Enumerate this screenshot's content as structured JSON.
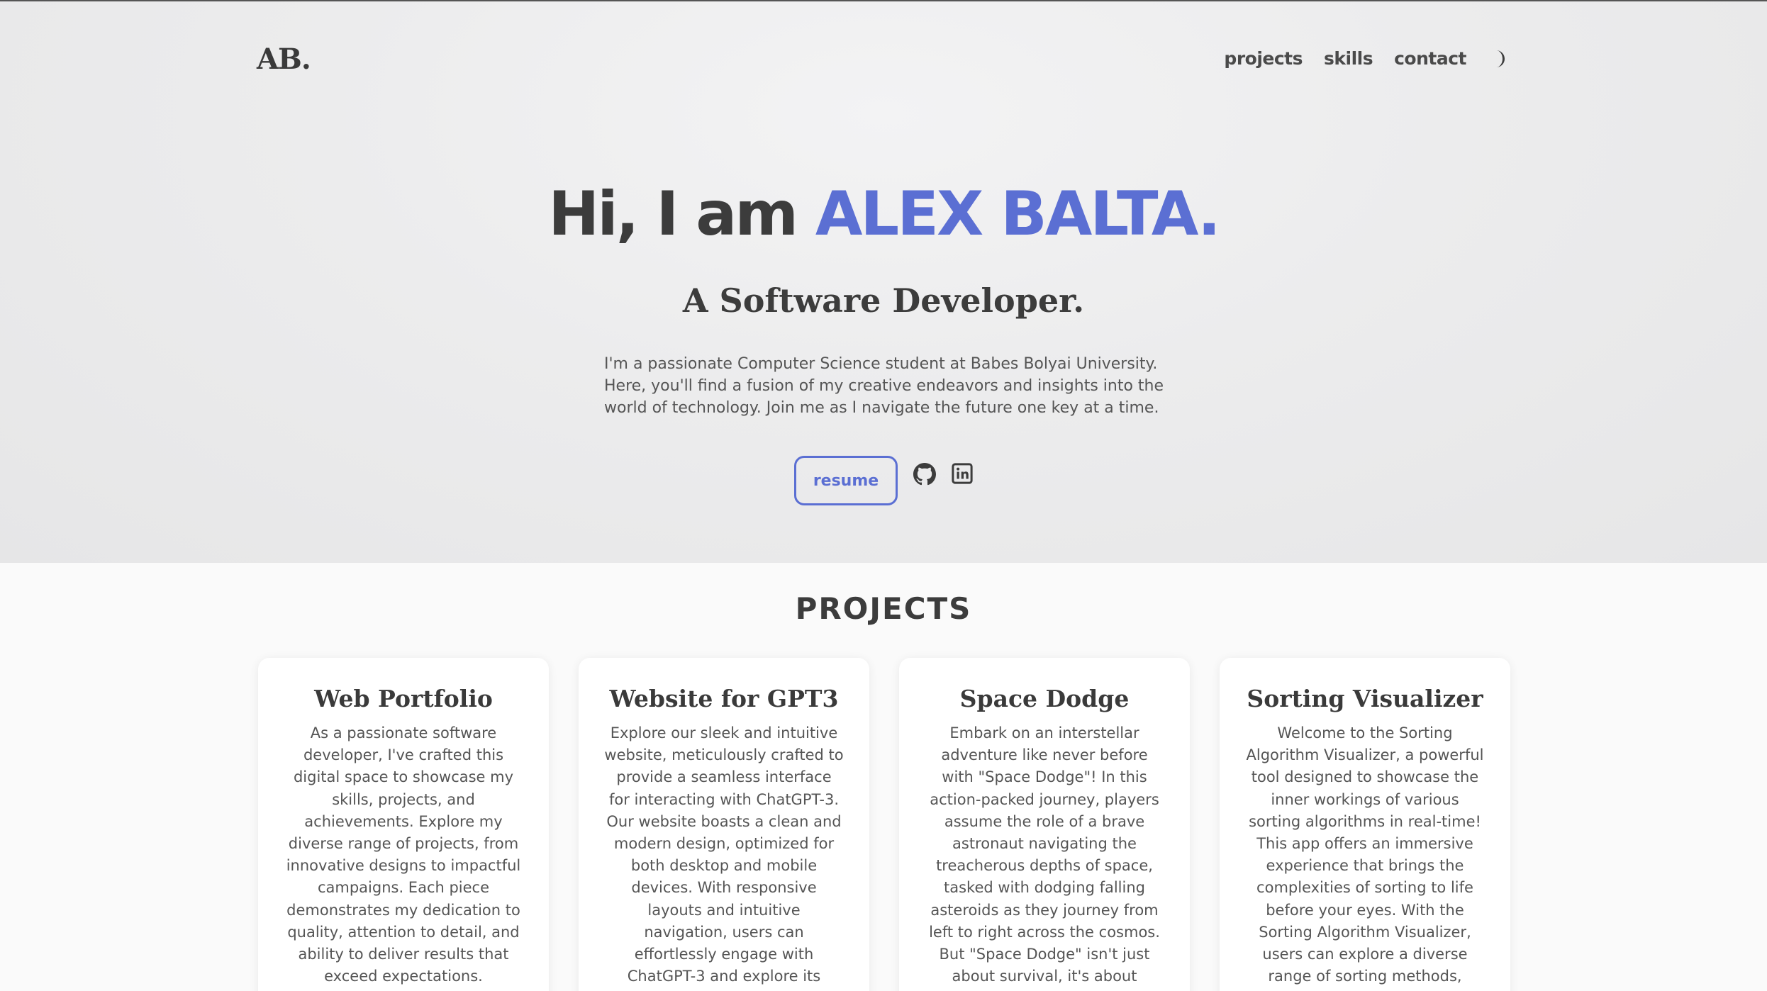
{
  "logo": "AB.",
  "nav": {
    "items": [
      "projects",
      "skills",
      "contact"
    ],
    "theme_icon": "moon-icon"
  },
  "hero": {
    "greeting": "Hi, I am ",
    "name": "ALEX BALTA.",
    "subtitle": "A Software Developer.",
    "intro": "I'm a passionate Computer Science student at Babes Bolyai University. Here, you'll find a fusion of my creative endeavors and insights into the world of technology. Join me as I navigate the future one key at a time.",
    "resume_label": "resume",
    "social_icons": [
      "github-icon",
      "linkedin-icon"
    ]
  },
  "projects": {
    "heading": "PROJECTS",
    "cards": [
      {
        "title": "Web Portfolio",
        "description": "As a passionate software developer, I've crafted this digital space to showcase my skills, projects, and achievements. Explore my diverse range of projects, from innovative designs to impactful campaigns. Each piece demonstrates my dedication to quality, attention to detail, and ability to deliver results that exceed expectations."
      },
      {
        "title": "Website for GPT3",
        "description": "Explore our sleek and intuitive website, meticulously crafted to provide a seamless interface for interacting with ChatGPT-3. Our website boasts a clean and modern design, optimized for both desktop and mobile devices. With responsive layouts and intuitive navigation, users can effortlessly engage with ChatGPT-3 and explore its"
      },
      {
        "title": "Space Dodge",
        "description": "Embark on an interstellar adventure like never before with \"Space Dodge\"! In this action-packed journey, players assume the role of a brave astronaut navigating the treacherous depths of space, tasked with dodging falling asteroids as they journey from left to right across the cosmos. But \"Space Dodge\" isn't just about survival, it's about"
      },
      {
        "title": "Sorting Visualizer",
        "description": "Welcome to the Sorting Algorithm Visualizer, a powerful tool designed to showcase the inner workings of various sorting algorithms in real-time! This app offers an immersive experience that brings the complexities of sorting to life before your eyes. With the Sorting Algorithm Visualizer, users can explore a diverse range of sorting methods,"
      }
    ]
  },
  "colors": {
    "accent": "#5b6fd3",
    "text": "#3c3c3c",
    "hero_bg": "#ececed",
    "page_bg": "#fafafa"
  }
}
